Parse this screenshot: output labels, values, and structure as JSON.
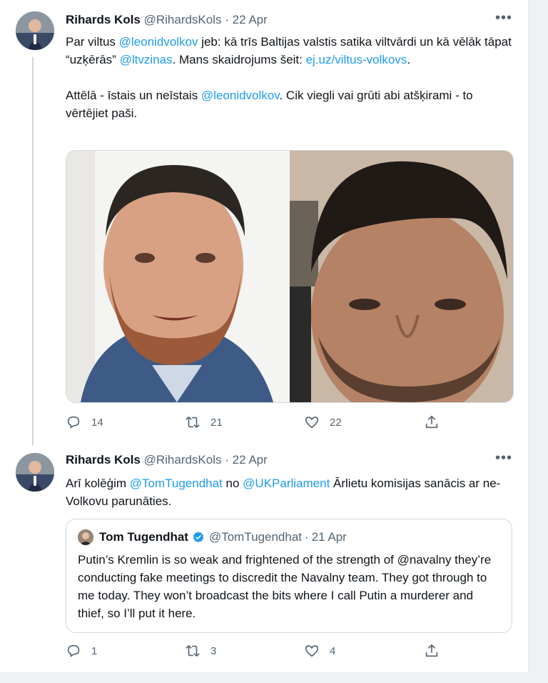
{
  "tweets": [
    {
      "author_name": "Rihards Kols",
      "handle": "@RihardsKols",
      "separator": "·",
      "date": "22 Apr",
      "more": "•••",
      "text": {
        "p1_a": "Par viltus ",
        "mention1": "@leonidvolkov",
        "p1_b": " jeb: kā trīs Baltijas valstis satika viltvārdi un kā vēlāk tāpat “uzķērās” ",
        "mention2": "@ltvzinas",
        "p1_c": ". Mans skaidrojums šeit: ",
        "link": "ej.uz/viltus-volkovs",
        "p1_d": ".",
        "p2_a": "Attēlā - īstais un neīstais ",
        "mention3": "@leonidvolkov",
        "p2_b": ". Cik viegli vai grūti abi atšķirami - to vērtējiet paši."
      },
      "actions": {
        "reply_icon": "reply-icon",
        "replies": "14",
        "retweet_icon": "retweet-icon",
        "retweets": "21",
        "like_icon": "heart-icon",
        "likes": "22",
        "share_icon": "share-icon"
      }
    },
    {
      "author_name": "Rihards Kols",
      "handle": "@RihardsKols",
      "separator": "·",
      "date": "22 Apr",
      "more": "•••",
      "text": {
        "a": "Arī kolēģim ",
        "mention1": "@TomTugendhat",
        "b": " no ",
        "mention2": "@UKParliament",
        "c": " Ārlietu komisijas sanācis ar ne-Volkovu parunāties."
      },
      "quote": {
        "author_name": "Tom Tugendhat",
        "handle": "@TomTugendhat",
        "separator": "·",
        "date": "21 Apr",
        "text": "Putin’s Kremlin is so weak and frightened of the strength of @navalny they’re conducting fake meetings to discredit the Navalny team. They got through to me today. They won’t broadcast the bits where I call Putin a murderer and thief, so I’ll put it here."
      },
      "actions": {
        "replies": "1",
        "retweets": "3",
        "likes": "4"
      }
    }
  ],
  "colors": {
    "link": "#1d9bf0",
    "muted": "#536471",
    "text": "#0f1419",
    "verified": "#1d9bf0"
  }
}
